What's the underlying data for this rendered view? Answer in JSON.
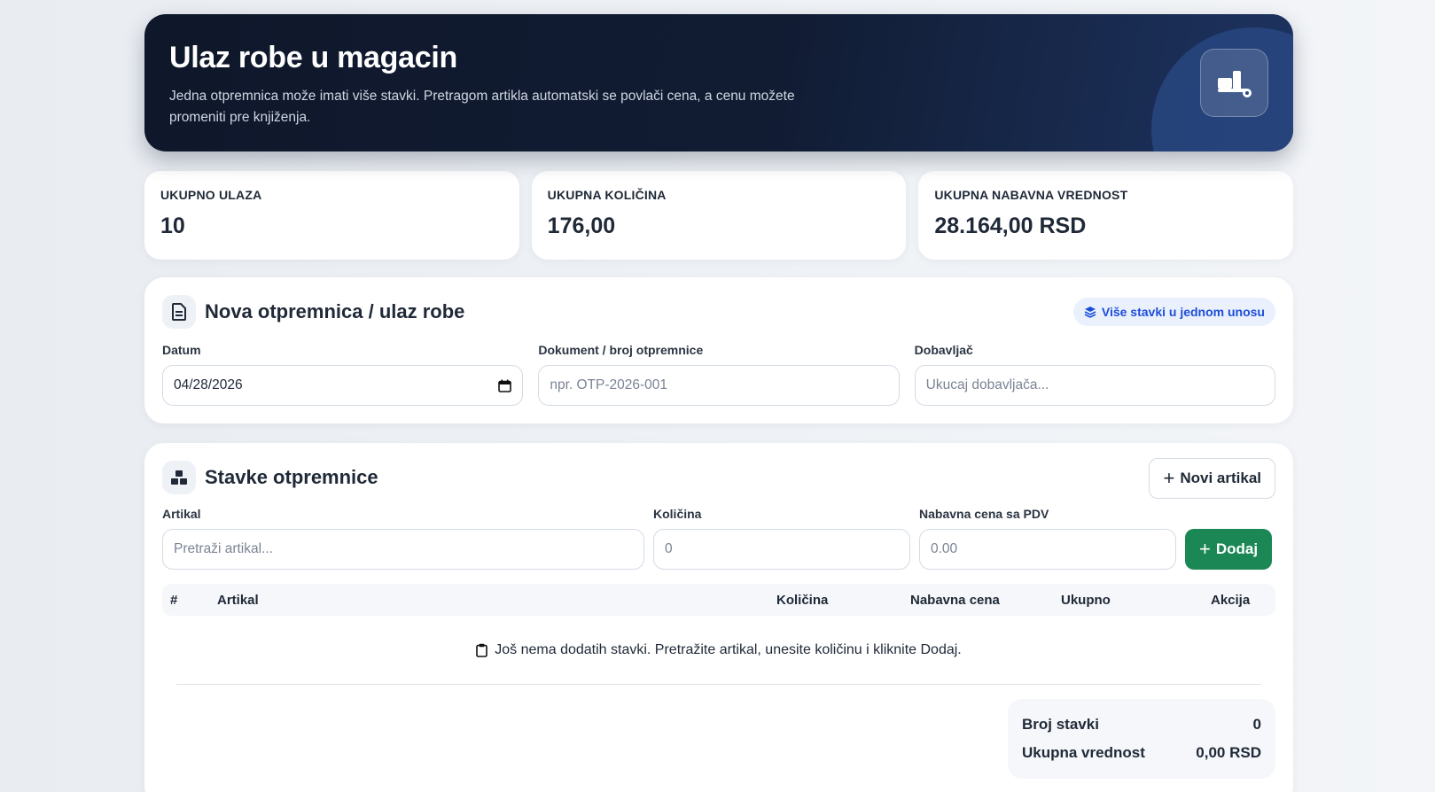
{
  "hero": {
    "title": "Ulaz robe u magacin",
    "description": "Jedna otpremnica može imati više stavki. Pretragom artikla automatski se povlači cena, a cenu možete promeniti pre knjiženja.",
    "icon": "dolly-icon"
  },
  "stats": [
    {
      "label": "UKUPNO ULAZA",
      "value": "10"
    },
    {
      "label": "UKUPNA KOLIČINA",
      "value": "176,00"
    },
    {
      "label": "UKUPNA NABAVNA VREDNOST",
      "value": "28.164,00 RSD"
    }
  ],
  "document_form": {
    "title": "Nova otpremnica / ulaz robe",
    "badge": "Više stavki u jednom unosu",
    "date_label": "Datum",
    "date_value": "04/28/2026",
    "document_label": "Dokument / broj otpremnice",
    "document_placeholder": "npr. OTP-2026-001",
    "supplier_label": "Dobavljač",
    "supplier_placeholder": "Ukucaj dobavljača..."
  },
  "items": {
    "title": "Stavke otpremnice",
    "new_article_button": "Novi artikal",
    "article_label": "Artikal",
    "article_placeholder": "Pretraži artikal...",
    "quantity_label": "Količina",
    "quantity_placeholder": "0",
    "price_label": "Nabavna cena sa PDV",
    "price_placeholder": "0.00",
    "add_button": "Dodaj",
    "columns": [
      "#",
      "Artikal",
      "Količina",
      "Nabavna cena",
      "Ukupno",
      "Akcija"
    ],
    "empty_message": "Još nema dodatih stavki. Pretražite artikal, unesite količinu i kliknite Dodaj.",
    "summary": {
      "count_label": "Broj stavki",
      "count_value": "0",
      "total_label": "Ukupna vrednost",
      "total_value": "0,00 RSD"
    }
  },
  "colors": {
    "hero_bg": "#0f172a",
    "accent_blue": "#1d4ed8",
    "success_green": "#1a8754"
  }
}
